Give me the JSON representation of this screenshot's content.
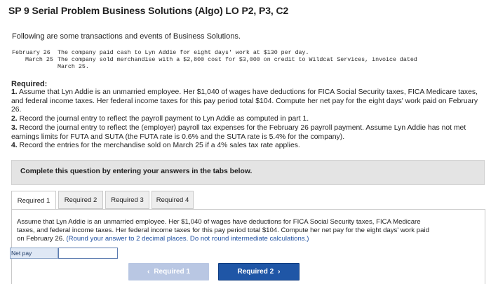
{
  "title": "SP 9 Serial Problem Business Solutions (Algo) LO P2, P3, C2",
  "intro": "Following are some transactions and events of Business Solutions.",
  "transactions": [
    {
      "date": "February 26",
      "text": "The company paid cash to Lyn Addie for eight days' work at $130 per day."
    },
    {
      "date": "March 25",
      "text": "The company sold merchandise with a $2,800 cost for $3,000 on credit to Wildcat Services, invoice dated"
    },
    {
      "date": "",
      "text": "March 25."
    }
  ],
  "required_heading": "Required:",
  "requirements": [
    {
      "num": "1.",
      "text": "Assume that Lyn Addie is an unmarried employee. Her $1,040 of wages have deductions for FICA Social Security taxes, FICA Medicare taxes, and federal income taxes. Her federal income taxes for this pay period total $104. Compute her net pay for the eight days' work paid on February 26."
    },
    {
      "num": "2.",
      "text": "Record the journal entry to reflect the payroll payment to Lyn Addie as computed in part 1."
    },
    {
      "num": "3.",
      "text": "Record the journal entry to reflect the (employer) payroll tax expenses for the February 26 payroll payment. Assume Lyn Addie has not met earnings limits for FUTA and SUTA (the FUTA rate is 0.6% and the SUTA rate is 5.4% for the company)."
    },
    {
      "num": "4.",
      "text": "Record the entries for the merchandise sold on March 25 if a 4% sales tax rate applies."
    }
  ],
  "complete_note": "Complete this question by entering your answers in the tabs below.",
  "tabs": [
    {
      "label": "Required 1",
      "active": true
    },
    {
      "label": "Required 2",
      "active": false
    },
    {
      "label": "Required 3",
      "active": false
    },
    {
      "label": "Required 4",
      "active": false
    }
  ],
  "content": {
    "text": "Assume that Lyn Addie is an unmarried employee. Her $1,040 of wages have deductions for FICA Social Security taxes, FICA Medicare taxes, and federal income taxes. Her federal income taxes for this pay period total $104. Compute her net pay for the eight days' work paid on February 26.",
    "note": "(Round your answer to 2 decimal places. Do not round intermediate calculations.)",
    "note_color": "#1e4fa0"
  },
  "net_pay": {
    "label": "Net pay",
    "value": ""
  },
  "nav": {
    "prev_label": "Required 1",
    "next_label": "Required 2",
    "prev_icon": "chevron-left-icon",
    "next_icon": "chevron-right-icon"
  }
}
